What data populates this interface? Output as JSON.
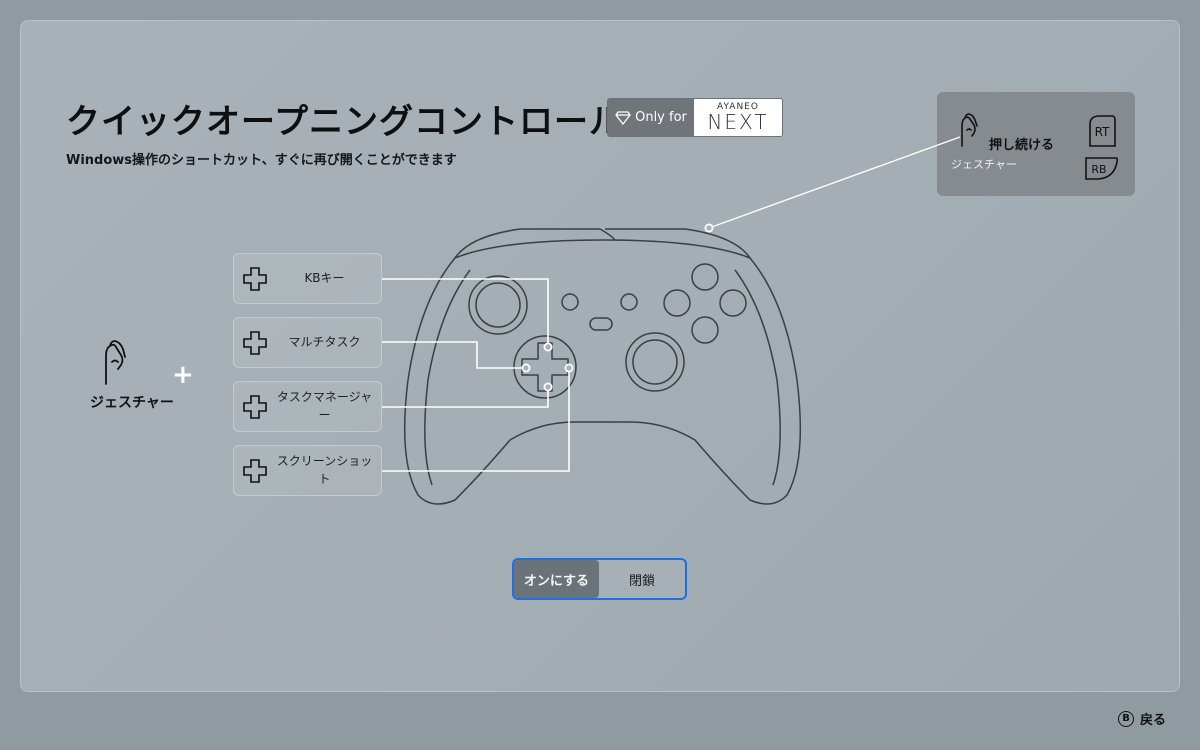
{
  "page": {
    "title": "クイックオープニングコントロール",
    "subtitle": "Windows操作のショートカット、すぐに再び開くことができます"
  },
  "badge": {
    "only_for": "Only for",
    "brand": "AYANEO",
    "model": "NEXT"
  },
  "hold_card": {
    "main_label": "押し続ける",
    "sub_label": "ジェスチャー",
    "rt_label": "RT",
    "rb_label": "RB"
  },
  "gesture": {
    "plus": "+",
    "label": "ジェスチャー"
  },
  "functions": [
    {
      "label": "KBキー"
    },
    {
      "label": "マルチタスク"
    },
    {
      "label": "タスクマネージャー"
    },
    {
      "label": "スクリーンショット"
    }
  ],
  "toggle": {
    "on_label": "オンにする",
    "off_label": "閉鎖",
    "selected": "on"
  },
  "footer": {
    "back_key": "B",
    "back_label": "戻る"
  },
  "colors": {
    "accent": "#1f6fe0",
    "panel": "#a7b0b6",
    "card_dark": "#868b8f"
  }
}
